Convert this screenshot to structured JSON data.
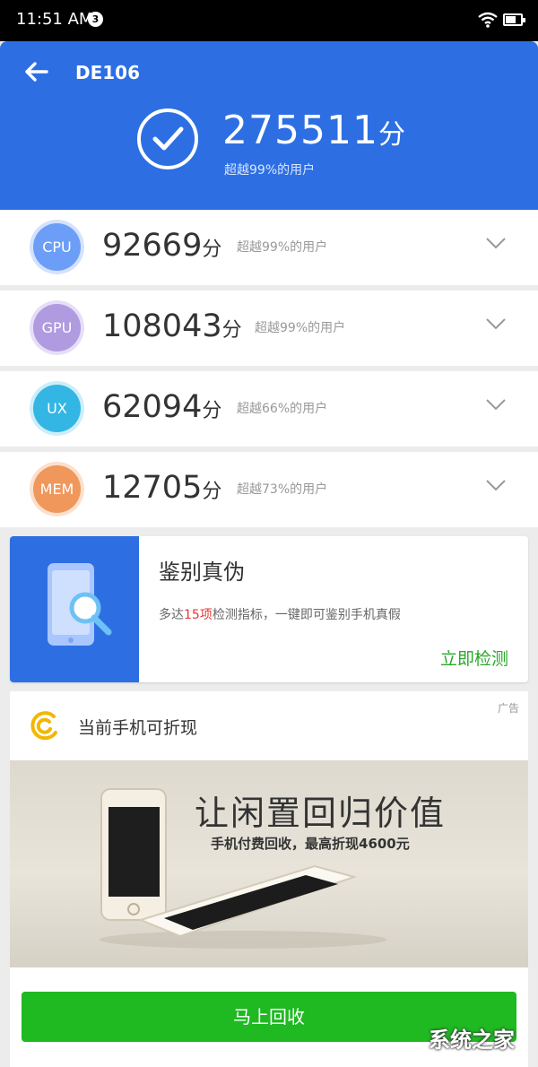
{
  "status_bar": {
    "time": "11:51 AM",
    "notification_count": "3"
  },
  "header": {
    "device_name": "DE106",
    "total_score": "275511",
    "total_unit": "分",
    "total_sub": "超越99%的用户",
    "bg_color": "#2d6fe3"
  },
  "scores": [
    {
      "label": "CPU",
      "score": "92669",
      "unit": "分",
      "sub": "超越99%的用户",
      "color": "#6c9ef8"
    },
    {
      "label": "GPU",
      "score": "108043",
      "unit": "分",
      "sub": "超越99%的用户",
      "color": "#b09ae0"
    },
    {
      "label": "UX",
      "score": "62094",
      "unit": "分",
      "sub": "超越66%的用户",
      "color": "#33b6e3"
    },
    {
      "label": "MEM",
      "score": "12705",
      "unit": "分",
      "sub": "超越73%的用户",
      "color": "#f0975c"
    }
  ],
  "verify": {
    "title": "鉴别真伪",
    "desc_prefix": "多达",
    "desc_highlight": "15项",
    "desc_suffix": "检测指标，一键即可鉴别手机真假",
    "action": "立即检测"
  },
  "ad": {
    "tag": "广告",
    "title": "当前手机可折现",
    "headline": "让闲置回归价值",
    "subline": "手机付费回收，最高折现4600元",
    "button": "马上回收"
  },
  "watermark": {
    "text": "系统之家"
  }
}
